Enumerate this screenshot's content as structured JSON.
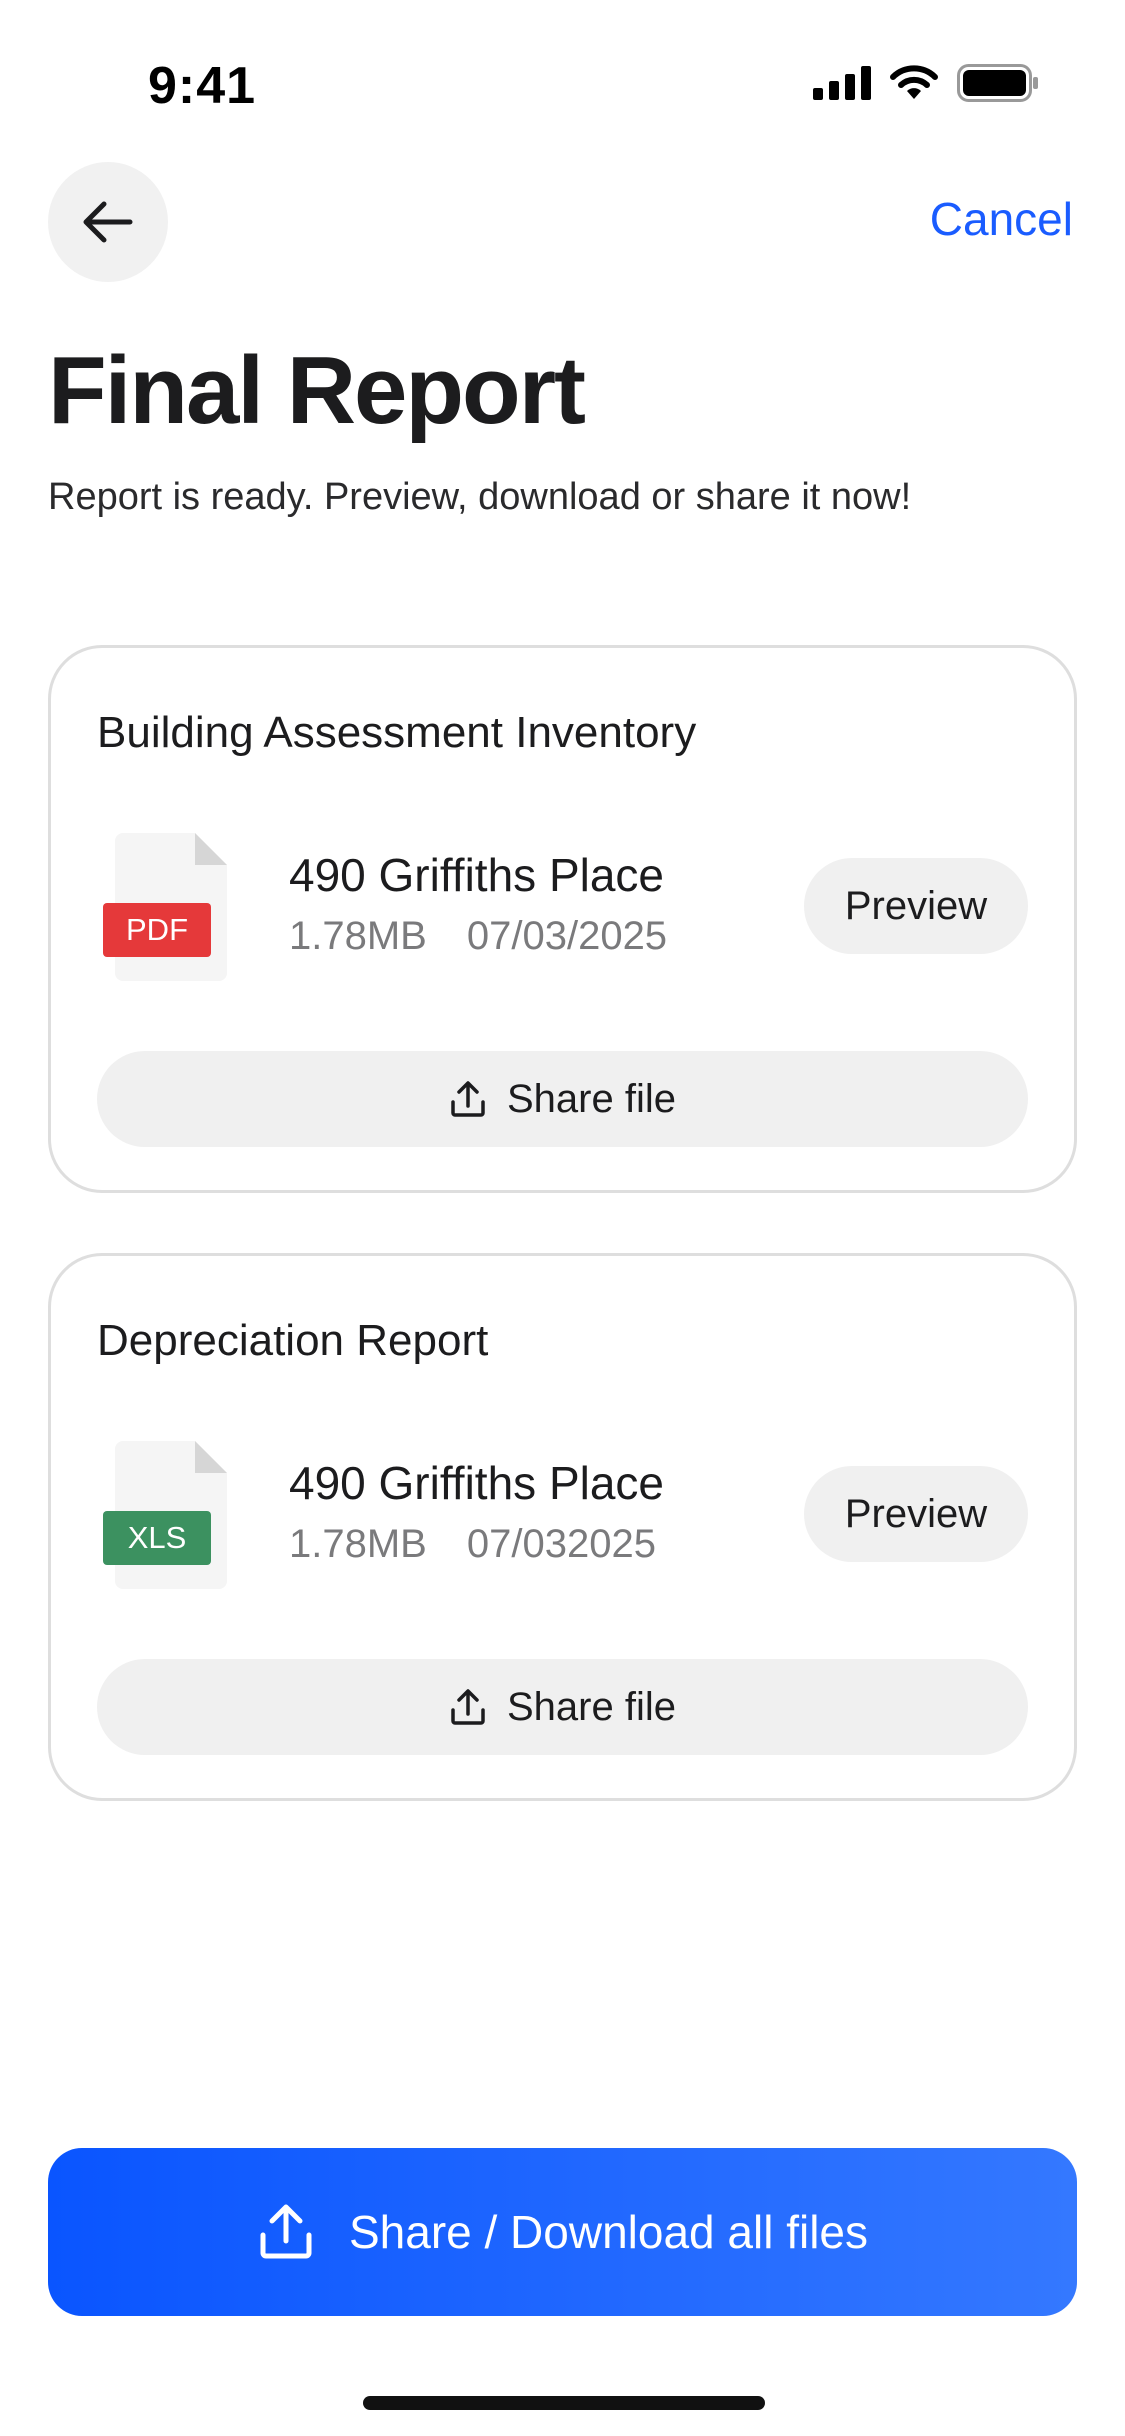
{
  "status_bar": {
    "time": "9:41"
  },
  "nav": {
    "cancel_label": "Cancel"
  },
  "header": {
    "title": "Final Report",
    "subtitle": "Report is ready. Preview, download or share it now!"
  },
  "cards": [
    {
      "title": "Building Assessment Inventory",
      "file_type": "PDF",
      "file_type_color": "#e5393a",
      "file_name": "490 Griffiths Place",
      "file_size": "1.78MB",
      "file_date": "07/03/2025",
      "preview_label": "Preview",
      "share_label": "Share file"
    },
    {
      "title": "Depreciation Report",
      "file_type": "XLS",
      "file_type_color": "#3c9160",
      "file_name": "490 Griffiths Place",
      "file_size": "1.78MB",
      "file_date": "07/032025",
      "preview_label": "Preview",
      "share_label": "Share file"
    }
  ],
  "cta": {
    "label": "Share / Download all files"
  },
  "colors": {
    "accent": "#1a5cff",
    "cta_gradient_start": "#0a55ff",
    "cta_gradient_end": "#3478ff"
  },
  "icons": {
    "back": "arrow-left-icon",
    "share": "upload-icon",
    "signal": "cellular-signal-icon",
    "wifi": "wifi-icon",
    "battery": "battery-icon"
  }
}
